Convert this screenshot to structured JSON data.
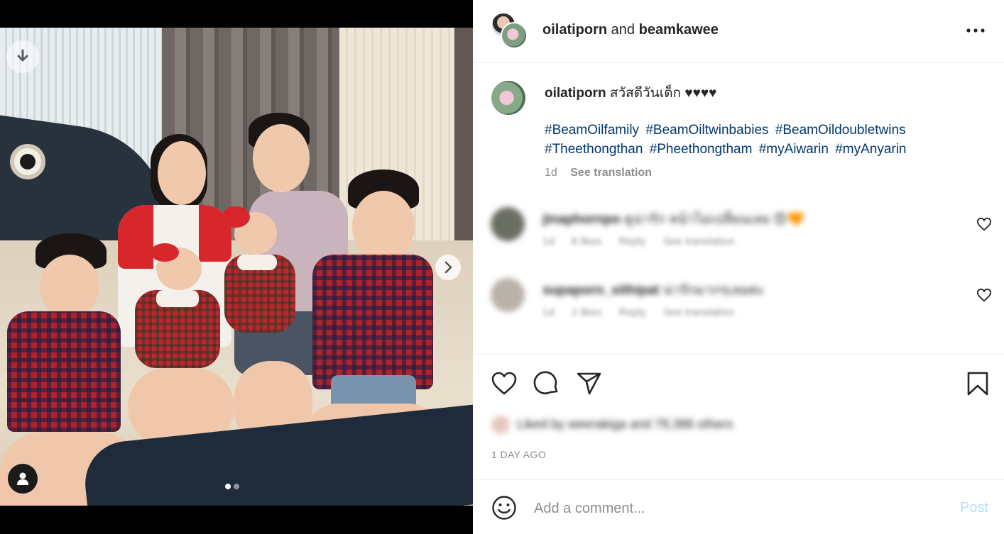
{
  "post": {
    "author": "oilatiporn",
    "connector": "and",
    "coauthor": "beamkawee",
    "caption_text": "สวัสดีวันเด็ก ♥♥♥♥",
    "hashtags": [
      "#BeamOilfamily",
      "#BeamOiltwinbabies",
      "#BeamOildoubletwins",
      "#Theethongthan",
      "#Pheethongtham",
      "#myAiwarin",
      "#myAnyarin"
    ],
    "caption_age": "1d",
    "see_translation": "See translation",
    "date": "1 DAY AGO"
  },
  "comments": [
    {
      "username": "jinaphornpo",
      "text": "ดูน่ารัก หน้าไม่เปลี่ยนเลย 😍🧡",
      "age": "1d",
      "likes": "8 likes",
      "reply": "Reply",
      "translate": "See translation",
      "avatar_color": "#6b6f63"
    },
    {
      "username": "supaporn_sithipat",
      "text": "น่ารักมากๆเลยค่ะ",
      "age": "1d",
      "likes": "2 likes",
      "reply": "Reply",
      "translate": "See translation",
      "avatar_color": "#b9b2a9"
    }
  ],
  "likes": {
    "text": "Liked by weerakiga and 78,386 others"
  },
  "add_comment": {
    "placeholder": "Add a comment...",
    "post_label": "Post"
  },
  "icons": {
    "download": "download-arrow-icon",
    "next": "chevron-right-icon",
    "tag": "user-tag-icon",
    "more": "more-horizontal-icon",
    "like": "heart-icon",
    "comment": "comment-bubble-icon",
    "share": "paper-plane-icon",
    "save": "bookmark-icon",
    "emoji": "smiley-icon"
  },
  "carousel": {
    "count": 2,
    "active": 0
  },
  "colors": {
    "hashtag": "#00376b",
    "muted": "#8e8e8e",
    "post_disabled": "#b2dffc",
    "text": "#262626"
  }
}
